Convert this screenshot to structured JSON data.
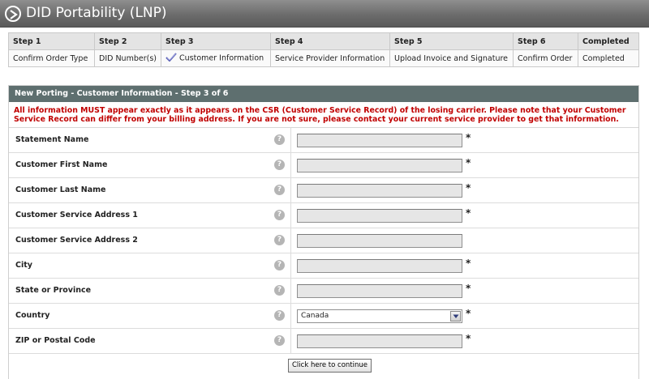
{
  "header": {
    "title": "DID Portability (LNP)"
  },
  "steps": {
    "headers": [
      "Step 1",
      "Step 2",
      "Step 3",
      "Step 4",
      "Step 5",
      "Step 6",
      "Completed"
    ],
    "values": [
      "Confirm Order Type",
      "DID Number(s)",
      "Customer Information",
      "Service Provider Information",
      "Upload Invoice and Signature",
      "Confirm Order",
      "Completed"
    ]
  },
  "form": {
    "panel_title": "New Porting - Customer Information - Step 3 of 6",
    "notice": "All information MUST appear exactly as it appears on the CSR (Customer Service Record) of the losing carrier. Please note that your Customer Service Record can differ from your billing address. If you are not sure, please contact your current service provider to get that information.",
    "help_symbol": "?",
    "required_symbol": "*",
    "fields": [
      {
        "label": "Statement Name",
        "value": ""
      },
      {
        "label": "Customer First Name",
        "value": ""
      },
      {
        "label": "Customer Last Name",
        "value": ""
      },
      {
        "label": "Customer Service Address 1",
        "value": ""
      },
      {
        "label": "Customer Service Address 2",
        "value": ""
      },
      {
        "label": "City",
        "value": ""
      },
      {
        "label": "State or Province",
        "value": ""
      },
      {
        "label": "Country",
        "selected": "Canada"
      },
      {
        "label": "ZIP or Postal Code",
        "value": ""
      }
    ],
    "continue_label": "Click here to continue"
  },
  "colors": {
    "header_bg": "#6c6c6c",
    "panel_head_bg": "#5e6f6f",
    "notice_text": "#c00000",
    "field_bg": "#e6e6e6"
  },
  "icons": {
    "header": "circle-arrow-right-icon",
    "step3": "checkmark-icon",
    "help": "question-mark-icon",
    "dropdown": "chevron-down-icon"
  }
}
